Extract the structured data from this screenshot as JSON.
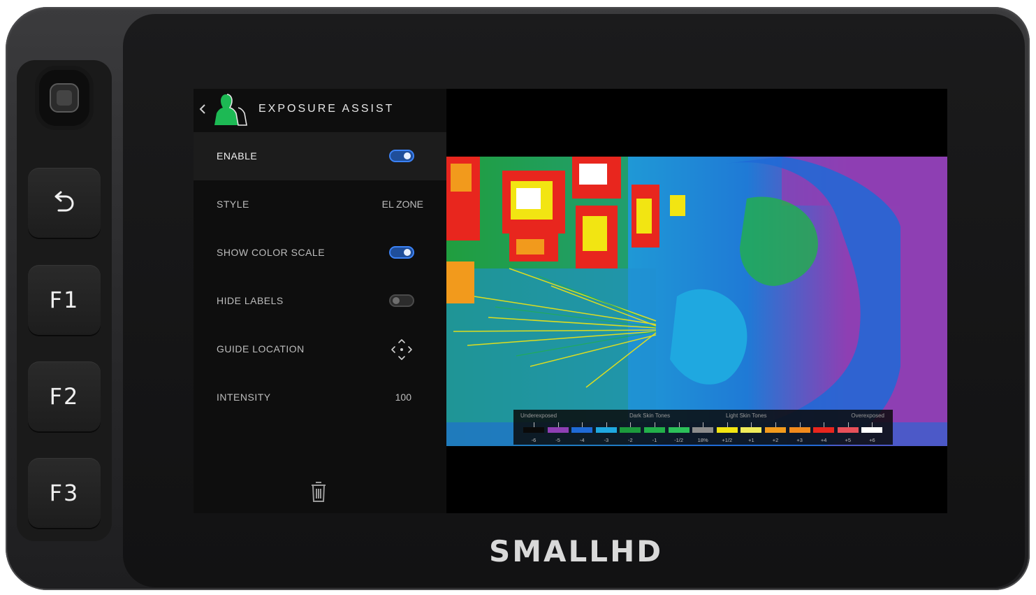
{
  "device": {
    "brand": "SMALLHD",
    "buttons": [
      {
        "id": "back",
        "icon": "undo-arrow-icon"
      },
      {
        "id": "f1",
        "label": "F1"
      },
      {
        "id": "f2",
        "label": "F2"
      },
      {
        "id": "f3",
        "label": "F3"
      }
    ]
  },
  "menu": {
    "title": "EXPOSURE ASSIST",
    "title_icon": "person-silhouette-icon",
    "accent_color": "#1db954",
    "toggle_on_color": "#3b82f6",
    "rows": [
      {
        "label": "ENABLE",
        "control": "toggle",
        "on": true
      },
      {
        "label": "STYLE",
        "control": "value",
        "value": "EL ZONE"
      },
      {
        "label": "SHOW COLOR SCALE",
        "control": "toggle",
        "on": true
      },
      {
        "label": "HIDE LABELS",
        "control": "toggle",
        "on": false
      },
      {
        "label": "GUIDE LOCATION",
        "control": "icon",
        "icon": "move-arrows-icon"
      },
      {
        "label": "INTENSITY",
        "control": "value",
        "value": "100"
      }
    ],
    "footer_icon": "trash-icon"
  },
  "color_scale": {
    "headers": [
      "Underexposed",
      "Dark Skin Tones",
      "Light Skin Tones",
      "Overexposed"
    ],
    "stops": [
      {
        "label": "-6",
        "color": "#0a0a0a"
      },
      {
        "label": "-5",
        "color": "#8e3fb3"
      },
      {
        "label": "-4",
        "color": "#1f6ad6"
      },
      {
        "label": "-3",
        "color": "#1fa8e0"
      },
      {
        "label": "-2",
        "color": "#1c9a3c"
      },
      {
        "label": "-1",
        "color": "#22b04a"
      },
      {
        "label": "-1/2",
        "color": "#2cc05a"
      },
      {
        "label": "18%",
        "color": "#8c8c8c"
      },
      {
        "label": "+1/2",
        "color": "#f2e512"
      },
      {
        "label": "+1",
        "color": "#f0ec5a"
      },
      {
        "label": "+2",
        "color": "#f29a1c"
      },
      {
        "label": "+3",
        "color": "#f28a1c"
      },
      {
        "label": "+4",
        "color": "#e8261e"
      },
      {
        "label": "+5",
        "color": "#e8505a"
      },
      {
        "label": "+6",
        "color": "#ffffff"
      }
    ]
  }
}
